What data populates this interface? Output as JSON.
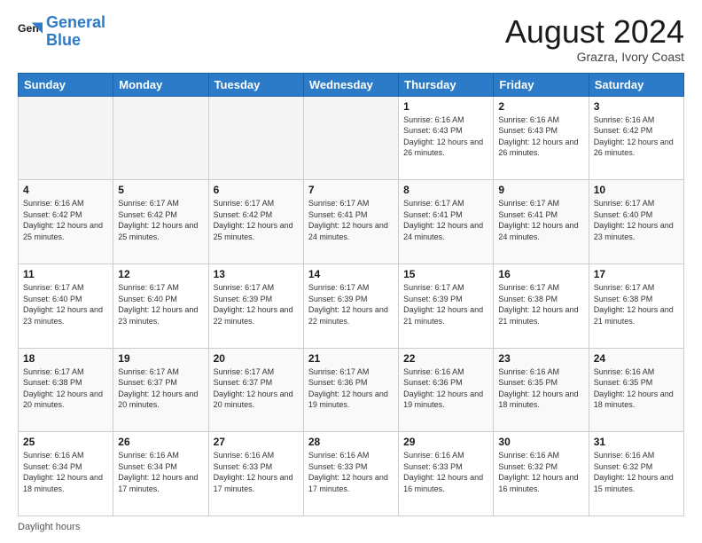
{
  "logo": {
    "text_general": "General",
    "text_blue": "Blue"
  },
  "header": {
    "title": "August 2024",
    "subtitle": "Grazra, Ivory Coast"
  },
  "weekdays": [
    "Sunday",
    "Monday",
    "Tuesday",
    "Wednesday",
    "Thursday",
    "Friday",
    "Saturday"
  ],
  "footer": {
    "label": "Daylight hours"
  },
  "weeks": [
    [
      {
        "day": "",
        "info": ""
      },
      {
        "day": "",
        "info": ""
      },
      {
        "day": "",
        "info": ""
      },
      {
        "day": "",
        "info": ""
      },
      {
        "day": "1",
        "info": "Sunrise: 6:16 AM\nSunset: 6:43 PM\nDaylight: 12 hours and 26 minutes."
      },
      {
        "day": "2",
        "info": "Sunrise: 6:16 AM\nSunset: 6:43 PM\nDaylight: 12 hours and 26 minutes."
      },
      {
        "day": "3",
        "info": "Sunrise: 6:16 AM\nSunset: 6:42 PM\nDaylight: 12 hours and 26 minutes."
      }
    ],
    [
      {
        "day": "4",
        "info": "Sunrise: 6:16 AM\nSunset: 6:42 PM\nDaylight: 12 hours and 25 minutes."
      },
      {
        "day": "5",
        "info": "Sunrise: 6:17 AM\nSunset: 6:42 PM\nDaylight: 12 hours and 25 minutes."
      },
      {
        "day": "6",
        "info": "Sunrise: 6:17 AM\nSunset: 6:42 PM\nDaylight: 12 hours and 25 minutes."
      },
      {
        "day": "7",
        "info": "Sunrise: 6:17 AM\nSunset: 6:41 PM\nDaylight: 12 hours and 24 minutes."
      },
      {
        "day": "8",
        "info": "Sunrise: 6:17 AM\nSunset: 6:41 PM\nDaylight: 12 hours and 24 minutes."
      },
      {
        "day": "9",
        "info": "Sunrise: 6:17 AM\nSunset: 6:41 PM\nDaylight: 12 hours and 24 minutes."
      },
      {
        "day": "10",
        "info": "Sunrise: 6:17 AM\nSunset: 6:40 PM\nDaylight: 12 hours and 23 minutes."
      }
    ],
    [
      {
        "day": "11",
        "info": "Sunrise: 6:17 AM\nSunset: 6:40 PM\nDaylight: 12 hours and 23 minutes."
      },
      {
        "day": "12",
        "info": "Sunrise: 6:17 AM\nSunset: 6:40 PM\nDaylight: 12 hours and 23 minutes."
      },
      {
        "day": "13",
        "info": "Sunrise: 6:17 AM\nSunset: 6:39 PM\nDaylight: 12 hours and 22 minutes."
      },
      {
        "day": "14",
        "info": "Sunrise: 6:17 AM\nSunset: 6:39 PM\nDaylight: 12 hours and 22 minutes."
      },
      {
        "day": "15",
        "info": "Sunrise: 6:17 AM\nSunset: 6:39 PM\nDaylight: 12 hours and 21 minutes."
      },
      {
        "day": "16",
        "info": "Sunrise: 6:17 AM\nSunset: 6:38 PM\nDaylight: 12 hours and 21 minutes."
      },
      {
        "day": "17",
        "info": "Sunrise: 6:17 AM\nSunset: 6:38 PM\nDaylight: 12 hours and 21 minutes."
      }
    ],
    [
      {
        "day": "18",
        "info": "Sunrise: 6:17 AM\nSunset: 6:38 PM\nDaylight: 12 hours and 20 minutes."
      },
      {
        "day": "19",
        "info": "Sunrise: 6:17 AM\nSunset: 6:37 PM\nDaylight: 12 hours and 20 minutes."
      },
      {
        "day": "20",
        "info": "Sunrise: 6:17 AM\nSunset: 6:37 PM\nDaylight: 12 hours and 20 minutes."
      },
      {
        "day": "21",
        "info": "Sunrise: 6:17 AM\nSunset: 6:36 PM\nDaylight: 12 hours and 19 minutes."
      },
      {
        "day": "22",
        "info": "Sunrise: 6:16 AM\nSunset: 6:36 PM\nDaylight: 12 hours and 19 minutes."
      },
      {
        "day": "23",
        "info": "Sunrise: 6:16 AM\nSunset: 6:35 PM\nDaylight: 12 hours and 18 minutes."
      },
      {
        "day": "24",
        "info": "Sunrise: 6:16 AM\nSunset: 6:35 PM\nDaylight: 12 hours and 18 minutes."
      }
    ],
    [
      {
        "day": "25",
        "info": "Sunrise: 6:16 AM\nSunset: 6:34 PM\nDaylight: 12 hours and 18 minutes."
      },
      {
        "day": "26",
        "info": "Sunrise: 6:16 AM\nSunset: 6:34 PM\nDaylight: 12 hours and 17 minutes."
      },
      {
        "day": "27",
        "info": "Sunrise: 6:16 AM\nSunset: 6:33 PM\nDaylight: 12 hours and 17 minutes."
      },
      {
        "day": "28",
        "info": "Sunrise: 6:16 AM\nSunset: 6:33 PM\nDaylight: 12 hours and 17 minutes."
      },
      {
        "day": "29",
        "info": "Sunrise: 6:16 AM\nSunset: 6:33 PM\nDaylight: 12 hours and 16 minutes."
      },
      {
        "day": "30",
        "info": "Sunrise: 6:16 AM\nSunset: 6:32 PM\nDaylight: 12 hours and 16 minutes."
      },
      {
        "day": "31",
        "info": "Sunrise: 6:16 AM\nSunset: 6:32 PM\nDaylight: 12 hours and 15 minutes."
      }
    ]
  ]
}
